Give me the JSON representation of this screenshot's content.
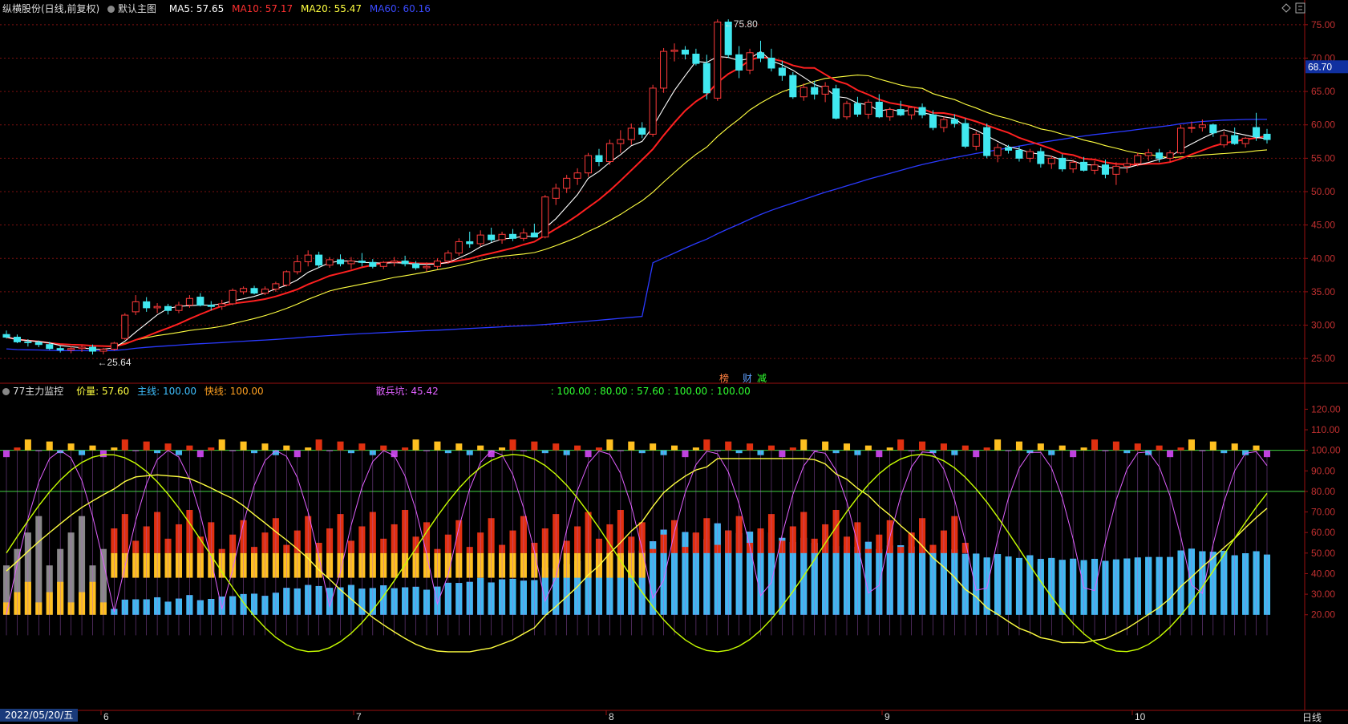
{
  "header": {
    "stock_name": "纵横股份(日线,前复权)",
    "main_chart_label": "默认主图",
    "ma5": "MA5: 57.65",
    "ma10": "MA10: 57.17",
    "ma20": "MA20: 55.47",
    "ma60": "MA60: 60.16",
    "colors": {
      "ma5": "#ffffff",
      "ma10": "#ff2020",
      "ma20": "#ffff40",
      "ma60": "#2a3aff"
    }
  },
  "indicator_header": {
    "name": "77主力监控",
    "jialiang": "价量: 57.60",
    "zhuxian": "主线: 100.00",
    "kuaixian": "快线: 100.00",
    "sanbing": "散兵坑: 45.42",
    "values_line": ": 100.00 : 80.00 : 57.60 : 100.00 : 100.00"
  },
  "tags": {
    "bang": "榜",
    "cai": "财",
    "jian": "减"
  },
  "current_price_label": "68.70",
  "price_axis_ticks": [
    "75.00",
    "70.00",
    "65.00",
    "60.00",
    "55.00",
    "50.00",
    "45.00",
    "40.00",
    "35.00",
    "30.00",
    "25.00"
  ],
  "indicator_axis_ticks": [
    "120.00",
    "110.00",
    "100.00",
    "90.00",
    "80.00",
    "70.00",
    "60.00",
    "50.00",
    "40.00",
    "30.00",
    "20.00"
  ],
  "date_label": "2022/05/20/五",
  "month_labels": [
    "6",
    "7",
    "8",
    "9",
    "10"
  ],
  "period_label": "日线",
  "icons": [
    "diamond-icon",
    "menu-icon",
    "collapse-circle-icon"
  ],
  "chart_data": [
    {
      "type": "candlestick",
      "title": "纵横股份(日线,前复权)",
      "ylim": [
        22.5,
        77.5
      ],
      "series": [
        {
          "name": "MA5",
          "color": "#ffffff"
        },
        {
          "name": "MA10",
          "color": "#ff2020"
        },
        {
          "name": "MA20",
          "color": "#ffff40"
        },
        {
          "name": "MA60",
          "color": "#2a3aff"
        }
      ],
      "high_annotation": "75.80",
      "low_annotation": "25.64",
      "candles": [
        [
          28.6,
          29.2,
          28.0,
          28.2
        ],
        [
          28.2,
          28.6,
          27.3,
          27.5
        ],
        [
          27.5,
          27.9,
          26.8,
          27.4
        ],
        [
          27.4,
          27.7,
          26.7,
          27.1
        ],
        [
          27.1,
          27.5,
          26.3,
          26.5
        ],
        [
          26.5,
          26.9,
          25.9,
          26.3
        ],
        [
          26.3,
          26.8,
          25.8,
          26.5
        ],
        [
          26.5,
          27.0,
          26.0,
          26.7
        ],
        [
          26.7,
          27.1,
          25.6,
          26.1
        ],
        [
          26.1,
          26.6,
          25.64,
          26.4
        ],
        [
          26.4,
          27.5,
          26.2,
          27.3
        ],
        [
          28.0,
          31.8,
          27.8,
          31.5
        ],
        [
          32.0,
          34.5,
          31.5,
          33.5
        ],
        [
          33.5,
          34.2,
          32.0,
          32.6
        ],
        [
          32.6,
          33.3,
          31.8,
          32.8
        ],
        [
          32.8,
          33.2,
          31.6,
          32.2
        ],
        [
          32.2,
          33.5,
          31.8,
          33.0
        ],
        [
          33.0,
          34.5,
          32.6,
          34.0
        ],
        [
          34.2,
          34.8,
          32.8,
          33.0
        ],
        [
          33.0,
          33.6,
          32.2,
          32.8
        ],
        [
          32.8,
          33.8,
          32.3,
          33.2
        ],
        [
          33.2,
          35.5,
          33.0,
          35.2
        ],
        [
          35.0,
          35.8,
          34.6,
          35.5
        ],
        [
          35.5,
          35.9,
          34.6,
          34.8
        ],
        [
          34.8,
          35.8,
          34.5,
          35.4
        ],
        [
          35.4,
          36.5,
          35.0,
          36.2
        ],
        [
          36.0,
          38.2,
          35.8,
          38.0
        ],
        [
          38.0,
          40.5,
          37.6,
          39.5
        ],
        [
          39.5,
          41.2,
          38.8,
          40.5
        ],
        [
          40.5,
          41.0,
          38.6,
          39.0
        ],
        [
          39.0,
          40.2,
          38.6,
          39.8
        ],
        [
          39.8,
          40.6,
          38.8,
          39.2
        ],
        [
          39.2,
          40.2,
          38.4,
          39.6
        ],
        [
          39.6,
          40.8,
          38.8,
          39.4
        ],
        [
          39.4,
          39.9,
          38.5,
          38.8
        ],
        [
          38.8,
          39.6,
          38.4,
          39.4
        ],
        [
          39.4,
          40.2,
          38.8,
          39.6
        ],
        [
          39.6,
          40.4,
          38.8,
          39.2
        ],
        [
          39.2,
          39.6,
          38.3,
          38.6
        ],
        [
          38.6,
          39.4,
          38.0,
          38.8
        ],
        [
          38.8,
          40.0,
          38.4,
          39.6
        ],
        [
          39.6,
          41.2,
          39.2,
          40.8
        ],
        [
          40.8,
          43.0,
          40.4,
          42.5
        ],
        [
          42.5,
          44.0,
          41.6,
          42.2
        ],
        [
          42.2,
          44.2,
          41.8,
          43.5
        ],
        [
          43.5,
          44.6,
          42.4,
          42.8
        ],
        [
          42.8,
          44.0,
          42.2,
          43.6
        ],
        [
          43.6,
          44.4,
          42.6,
          43.0
        ],
        [
          43.0,
          44.5,
          42.6,
          43.8
        ],
        [
          43.8,
          45.2,
          43.2,
          43.2
        ],
        [
          43.2,
          49.5,
          43.0,
          49.2
        ],
        [
          49.0,
          51.2,
          48.0,
          50.5
        ],
        [
          50.5,
          52.5,
          49.8,
          52.0
        ],
        [
          52.0,
          53.5,
          51.0,
          52.8
        ],
        [
          52.8,
          55.8,
          52.2,
          55.4
        ],
        [
          55.4,
          56.4,
          53.8,
          54.5
        ],
        [
          54.5,
          57.8,
          54.0,
          57.2
        ],
        [
          57.2,
          59.2,
          55.8,
          57.8
        ],
        [
          57.8,
          60.2,
          57.0,
          59.5
        ],
        [
          59.5,
          60.4,
          58.0,
          58.6
        ],
        [
          58.6,
          66.0,
          58.2,
          65.5
        ],
        [
          65.5,
          71.5,
          64.8,
          71.0
        ],
        [
          71.0,
          72.2,
          69.5,
          71.2
        ],
        [
          71.2,
          71.8,
          69.8,
          70.6
        ],
        [
          70.6,
          71.4,
          68.9,
          69.2
        ],
        [
          69.2,
          70.5,
          63.8,
          64.8
        ],
        [
          64.0,
          75.8,
          63.6,
          75.4
        ],
        [
          75.4,
          75.8,
          70.0,
          70.5
        ],
        [
          70.5,
          71.8,
          67.0,
          68.2
        ],
        [
          68.2,
          71.4,
          67.6,
          70.8
        ],
        [
          70.8,
          72.6,
          69.4,
          70.0
        ],
        [
          70.0,
          71.4,
          68.0,
          68.5
        ],
        [
          68.5,
          69.6,
          66.6,
          67.4
        ],
        [
          67.4,
          67.9,
          63.9,
          64.2
        ],
        [
          64.2,
          66.2,
          63.6,
          65.6
        ],
        [
          65.6,
          66.6,
          63.8,
          64.6
        ],
        [
          64.6,
          66.4,
          63.4,
          65.8
        ],
        [
          65.4,
          66.0,
          60.8,
          61.0
        ],
        [
          61.2,
          63.6,
          60.8,
          63.2
        ],
        [
          63.2,
          64.2,
          61.2,
          61.6
        ],
        [
          61.6,
          63.8,
          60.9,
          63.4
        ],
        [
          63.4,
          64.6,
          61.0,
          61.2
        ],
        [
          61.2,
          62.6,
          60.6,
          62.3
        ],
        [
          62.3,
          63.6,
          61.3,
          61.5
        ],
        [
          61.5,
          62.8,
          60.8,
          62.6
        ],
        [
          62.6,
          63.2,
          61.0,
          61.5
        ],
        [
          61.5,
          62.2,
          59.2,
          59.6
        ],
        [
          59.6,
          61.2,
          58.9,
          60.8
        ],
        [
          60.8,
          61.6,
          59.6,
          60.2
        ],
        [
          60.2,
          61.0,
          56.5,
          56.8
        ],
        [
          56.8,
          59.0,
          56.2,
          58.6
        ],
        [
          59.6,
          60.2,
          55.0,
          55.4
        ],
        [
          55.4,
          57.2,
          54.4,
          56.6
        ],
        [
          56.6,
          57.0,
          55.7,
          56.2
        ],
        [
          56.2,
          56.8,
          54.5,
          55.0
        ],
        [
          55.0,
          56.4,
          54.4,
          56.0
        ],
        [
          56.0,
          56.6,
          53.6,
          54.2
        ],
        [
          54.2,
          55.4,
          53.4,
          55.0
        ],
        [
          55.0,
          55.6,
          53.0,
          53.4
        ],
        [
          53.4,
          54.8,
          52.8,
          54.4
        ],
        [
          54.4,
          55.2,
          53.0,
          53.2
        ],
        [
          53.2,
          54.6,
          52.6,
          54.0
        ],
        [
          54.0,
          54.8,
          52.0,
          52.6
        ],
        [
          52.6,
          54.4,
          51.0,
          53.8
        ],
        [
          53.8,
          55.0,
          52.8,
          54.2
        ],
        [
          54.2,
          55.8,
          53.8,
          55.4
        ],
        [
          55.4,
          56.4,
          54.6,
          55.8
        ],
        [
          55.8,
          56.4,
          54.4,
          55.0
        ],
        [
          55.0,
          56.2,
          54.4,
          55.8
        ],
        [
          55.8,
          60.0,
          55.6,
          59.5
        ],
        [
          59.5,
          60.5,
          58.8,
          59.6
        ],
        [
          59.6,
          60.8,
          59.0,
          60.0
        ],
        [
          60.0,
          60.2,
          58.2,
          58.8
        ],
        [
          57.0,
          59.0,
          56.6,
          58.4
        ],
        [
          58.4,
          59.6,
          57.0,
          57.2
        ],
        [
          57.2,
          58.2,
          56.6,
          58.0
        ],
        [
          59.6,
          61.8,
          57.6,
          58.2
        ],
        [
          58.6,
          59.4,
          57.2,
          57.8
        ]
      ]
    },
    {
      "type": "bar",
      "title": "77主力监控",
      "ylim": [
        0,
        130
      ],
      "reference_lines": [
        100,
        80
      ],
      "series": [
        {
          "name": "主线",
          "color": "#ffff40"
        },
        {
          "name": "快线",
          "color": "#c8ff00"
        },
        {
          "name": "散兵坑",
          "color": "#e060ff"
        }
      ]
    }
  ]
}
